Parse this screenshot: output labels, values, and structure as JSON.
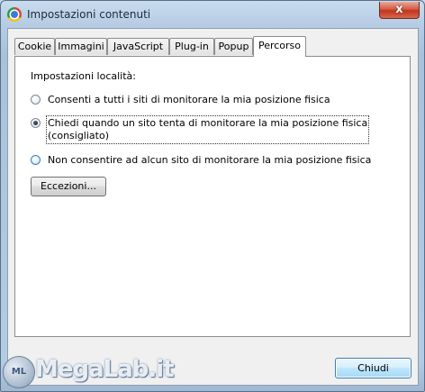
{
  "window": {
    "title": "Impostazioni contenuti",
    "close_glyph": "x",
    "app_icon": "chrome-icon"
  },
  "tabs": [
    {
      "label": "Cookie"
    },
    {
      "label": "Immagini"
    },
    {
      "label": "JavaScript"
    },
    {
      "label": "Plug-in"
    },
    {
      "label": "Popup"
    },
    {
      "label": "Percorso",
      "active": true
    }
  ],
  "location": {
    "heading": "Impostazioni località:",
    "options": [
      {
        "label": "Consenti a tutti i siti di monitorare la mia posizione fisica",
        "checked": false
      },
      {
        "label_line1": "Chiedi quando un sito tenta di monitorare la mia posizione fisica",
        "label_line2": "(consigliato)",
        "checked": true
      },
      {
        "label": "Non consentire ad alcun sito di monitorare la mia posizione fisica",
        "checked": false
      }
    ],
    "exceptions_button": "Eccezioni..."
  },
  "footer": {
    "close_button": "Chiudi"
  },
  "watermark": {
    "badge": "ML",
    "text": "MegaLab.it"
  }
}
